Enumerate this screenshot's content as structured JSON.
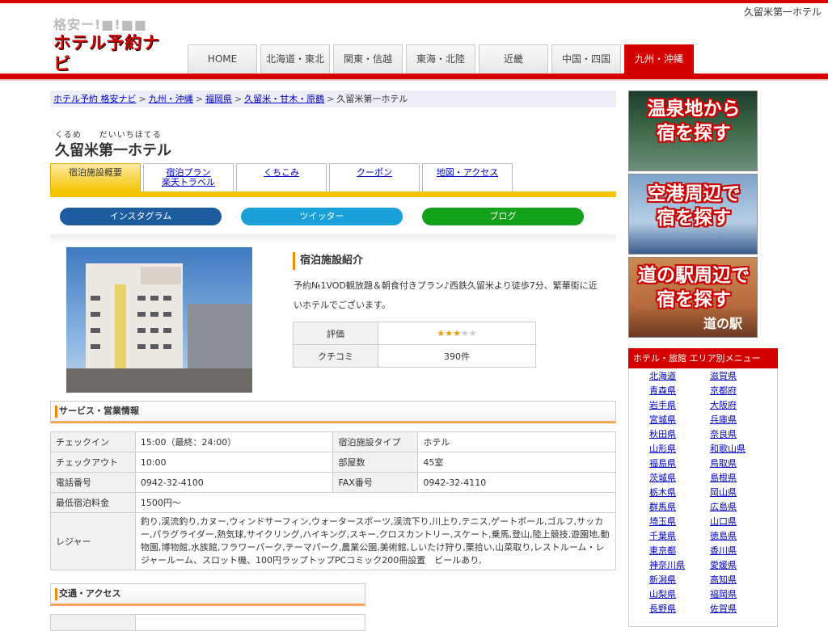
{
  "header": {
    "site_name": "久留米第一ホテル",
    "logo_line1": "格安ー!■!■■",
    "logo_line2": "ホテル予約ナビ",
    "nav": [
      "HOME",
      "北海道・東北",
      "関東・信越",
      "東海・北陸",
      "近畿",
      "中国・四国",
      "九州・沖縄"
    ],
    "active_nav": "九州・沖縄"
  },
  "breadcrumb": {
    "items": [
      "ホテル予約 格安ナビ",
      "九州・沖縄",
      "福岡県",
      "久留米・甘木・原鶴"
    ],
    "current": "久留米第一ホテル",
    "separator": ">"
  },
  "hotel": {
    "ruby": "くるめ　　だいいちほてる",
    "name": "久留米第一ホテル"
  },
  "tabs": [
    {
      "label": "宿泊施設概要",
      "active": true
    },
    {
      "label": "宿泊プラン\n楽天トラベル",
      "active": false
    },
    {
      "label": "くちこみ",
      "active": false
    },
    {
      "label": "クーポン",
      "active": false
    },
    {
      "label": "地図・アクセス",
      "active": false
    }
  ],
  "social": {
    "instagram": "インスタグラム",
    "twitter": "ツイッター",
    "blog": "ブログ",
    "colors": {
      "instagram": "#1d5c9e",
      "twitter": "#1aa0d8",
      "blog": "#13a01b"
    }
  },
  "intro": {
    "heading": "宿泊施設紹介",
    "text": "予約№1VOD観放題＆朝食付きプラン♪西鉄久留米より徒歩7分、繁華街に近いホテルでございます。",
    "rating_label": "評価",
    "rating_stars": 3,
    "rating_max": 5,
    "reviews_label": "クチコミ",
    "reviews_value": "390件"
  },
  "services": {
    "heading": "サービス・営業情報",
    "checkin_label": "チェックイン",
    "checkin_value": "15:00（最終：24:00）",
    "type_label": "宿泊施設タイプ",
    "type_value": "ホテル",
    "checkout_label": "チェックアウト",
    "checkout_value": "10:00",
    "rooms_label": "部屋数",
    "rooms_value": "45室",
    "phone_label": "電話番号",
    "phone_value": "0942-32-4100",
    "fax_label": "FAX番号",
    "fax_value": "0942-32-4110",
    "minprice_label": "最低宿泊料金",
    "minprice_value": "1500円～",
    "leisure_label": "レジャー",
    "leisure_value": "釣り,渓流釣り,カヌー,ウィンドサーフィン,ウォータースポーツ,渓流下り,川上り,テニス,ゲートボール,ゴルフ,サッカー,パラグライダー,熱気球,サイクリング,ハイキング,スキー,クロスカントリー,スケート,乗馬,登山,陸上競技,遊園地,動物園,博物館,水族館,フラワーパーク,テーマパーク,農業公園,美術館,しいたけ狩り,栗拾い,山菜取り,レストルーム・レジャールーム、スロット機、100円ラップトップPCコミック200冊設置　ビールあり,"
  },
  "access": {
    "heading": "交通・アクセス"
  },
  "sidebar": {
    "banner1": [
      "温泉地から",
      "宿を探す"
    ],
    "banner2": [
      "空港周辺で",
      "宿を探す"
    ],
    "banner3": [
      "道の駅周辺で",
      "宿を探す"
    ],
    "banner3_sub": "道の駅",
    "area_heading": "ホテル・旅館 エリア別メニュー",
    "prefectures": [
      "北海道",
      "滋賀県",
      "青森県",
      "京都府",
      "岩手県",
      "大阪府",
      "宮城県",
      "兵庫県",
      "秋田県",
      "奈良県",
      "山形県",
      "和歌山県",
      "福島県",
      "鳥取県",
      "茨城県",
      "島根県",
      "栃木県",
      "岡山県",
      "群馬県",
      "広島県",
      "埼玉県",
      "山口県",
      "千葉県",
      "徳島県",
      "東京都",
      "香川県",
      "神奈川県",
      "愛媛県",
      "新潟県",
      "高知県",
      "山梨県",
      "福岡県",
      "長野県",
      "佐賀県"
    ]
  },
  "colors": {
    "brand_red": "#d40000",
    "tab_yellow": "#f5c400",
    "accent_orange": "#f08a00"
  }
}
